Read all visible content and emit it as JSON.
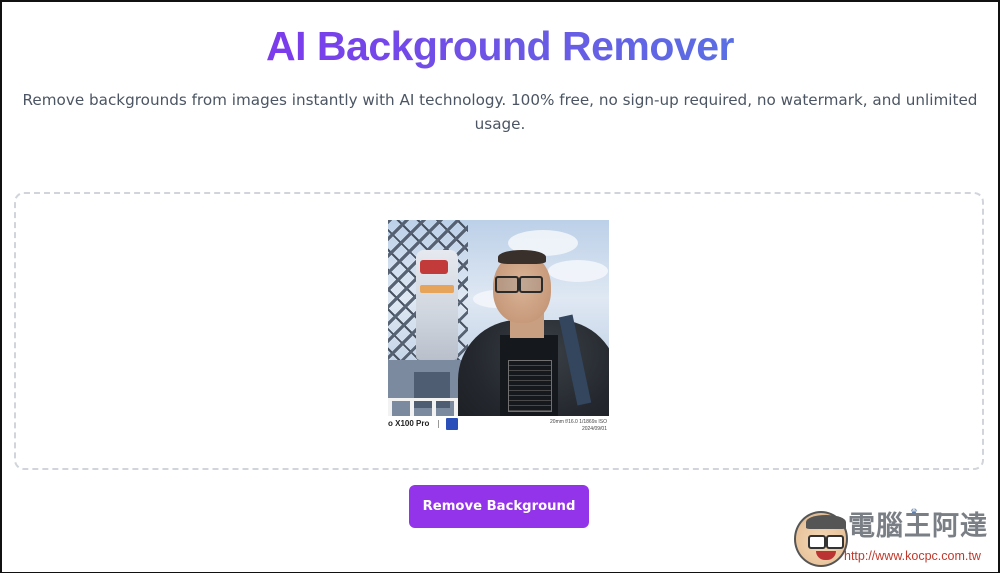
{
  "header": {
    "title": "AI Background Remover",
    "subtitle": "Remove backgrounds from images instantly with AI technology. 100% free, no sign-up required, no watermark, and unlimited usage.",
    "title_gradient": [
      "#7c3aed",
      "#5a6fe4"
    ]
  },
  "upload": {
    "preview_image_alt": "Uploaded photo: selfie in front of a giant robot statue",
    "caption_model": "o X100 Pro",
    "caption_specs_line1": "20mm f/16.0 1/1869s ISO",
    "caption_specs_line2": "2024/09/01"
  },
  "actions": {
    "remove_background_label": "Remove Background",
    "button_color": "#9333ea"
  },
  "watermark": {
    "name": "電腦王阿達",
    "url": "http://www.kocpc.com.tw"
  }
}
